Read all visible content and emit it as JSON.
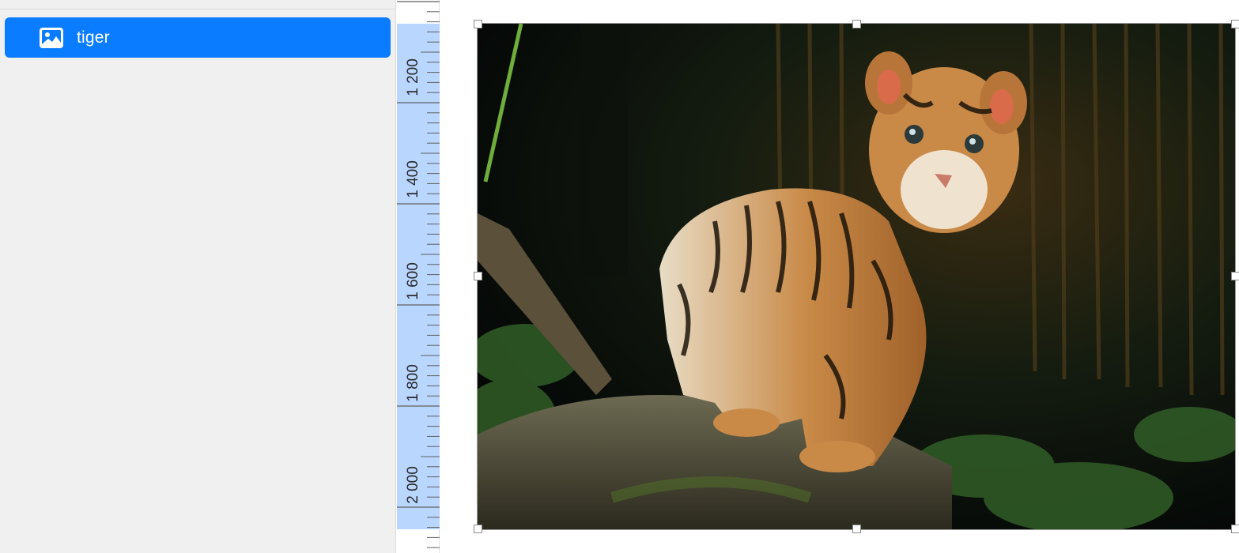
{
  "layers": {
    "selected_item": {
      "label": "tiger",
      "icon": "image-icon"
    }
  },
  "ruler": {
    "orientation": "vertical",
    "labels": [
      "1 200",
      "1 400",
      "1 600",
      "1 800",
      "2 000"
    ]
  },
  "canvas": {
    "image_layer_name": "tiger",
    "selected": true
  },
  "colors": {
    "accent": "#0a7cff",
    "ruler_highlight": "#b9d6ff",
    "ruler_tick": "#5f5f5f",
    "sidebar_bg": "#f0f0f0"
  }
}
